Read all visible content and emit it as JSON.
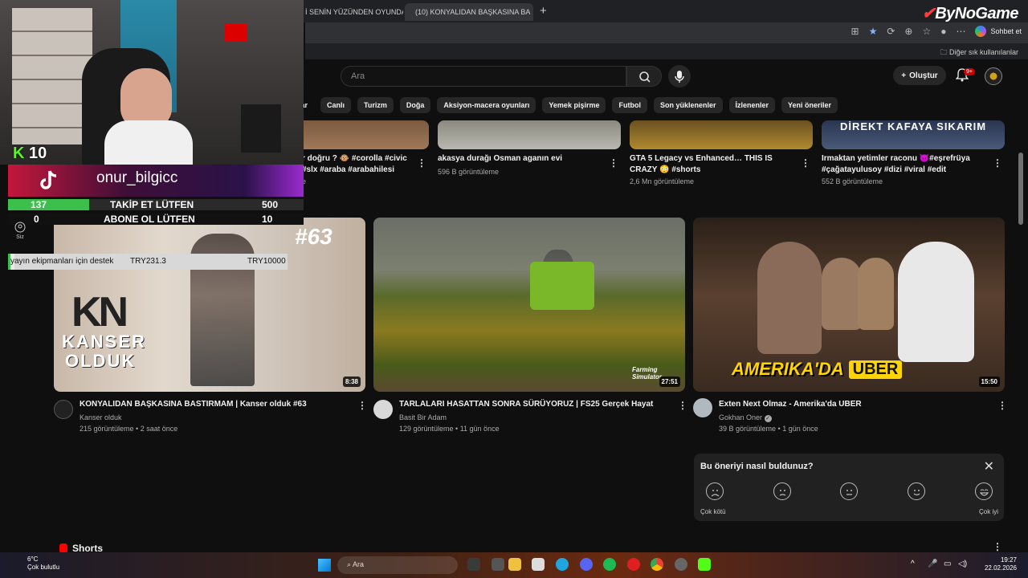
{
  "browser": {
    "tabs": [
      {
        "label": "İ SENİN YÜZÜNDEN OYUNDA |"
      },
      {
        "label": "(10) KONYALIDAN BAŞKASINA BA"
      }
    ],
    "chat_label": "Sohbet et",
    "other_bookmarks": "Diğer sık kullanılanlar"
  },
  "watermark": {
    "brand": "ByNoGame"
  },
  "youtube": {
    "search_placeholder": "Ara",
    "create_label": "Oluştur",
    "notif_count": "9+",
    "chips": [
      "lar",
      "Canlı",
      "Turizm",
      "Doğa",
      "Aksiyon-macera oyunları",
      "Yemek pişirme",
      "Futbol",
      "Son yüklenenler",
      "İzlenenler",
      "Yeni öneriler"
    ],
    "top_row": [
      {
        "title_l1": "r doğru ? 🐵 #corolla #civic",
        "title_l2": "#slx #araba #arabahilesi",
        "meta": "e"
      },
      {
        "title_l1": "akasya durağı Osman aganın evi",
        "title_l2": "",
        "meta": "596 B görüntüleme"
      },
      {
        "title_l1": "GTA 5 Legacy vs Enhanced… THIS IS",
        "title_l2": "CRAZY 😳 #shorts",
        "meta": "2,6 Mn görüntüleme"
      },
      {
        "title_l1": "Irmaktan yetimler raconu 😈#eşrefrüya",
        "title_l2": "#çağatayulusoy #dizi #viral #edit",
        "meta": "552 B görüntüleme",
        "thumb_text": "DİREKT KAFAYA SIKARIM"
      }
    ],
    "videos": [
      {
        "title": "KONYALIDAN BAŞKASINA BASTIRMAM  | Kanser olduk #63",
        "channel": "Kanser olduk",
        "meta": "215 görüntüleme • 2 saat önce",
        "duration": "8:38",
        "thumb_tag": "#63",
        "thumb_logo": "KN",
        "thumb_line1": "KANSER",
        "thumb_line2": "OLDUK"
      },
      {
        "title": "TARLALARI HASATTAN SONRA SÜRÜYORUZ | FS25 Gerçek Hayat",
        "channel": "Basit Bir Adam",
        "meta": "129 görüntüleme • 11 gün önce",
        "duration": "27:51",
        "thumb_tag": "Farming Simulator"
      },
      {
        "title": "Exten Next Olmaz - Amerika'da UBER",
        "channel": "Gokhan Oner",
        "meta": "39 B görüntüleme • 1 gün önce",
        "duration": "15:50",
        "thumb_tag": "AMERIKA'DA",
        "thumb_tag2": "UBER"
      }
    ],
    "feedback": {
      "question": "Bu öneriyi nasıl buldunuz?",
      "low_label": "Çok kötü",
      "high_label": "Çok iyi"
    },
    "shorts_label": "Shorts",
    "sidebar_you": "Siz"
  },
  "overlay": {
    "kick_count": "10",
    "tiktok_name": "onur_bilgicc",
    "follow_current": "137",
    "follow_text": "TAKİP ET LÜTFEN",
    "follow_goal": "500",
    "follow_progress": 0.274,
    "sub_current": "0",
    "sub_text": "ABONE OL LÜTFEN",
    "sub_goal": "10",
    "sub_progress": 0,
    "donate_text": "yayın ekipmanları için destek",
    "donate_current": "TRY231.3",
    "donate_goal": "TRY10000",
    "donate_progress": 0.023
  },
  "taskbar": {
    "temp": "6°C",
    "weather": "Çok bulutlu",
    "search": "Ara",
    "time": "19:27",
    "date": "22.02.2026"
  }
}
